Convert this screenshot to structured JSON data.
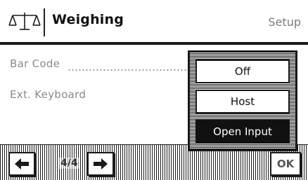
{
  "header": {
    "icon": "balance-scale-icon",
    "title": "Weighing",
    "right_label": "Setup"
  },
  "list": {
    "items": [
      {
        "label": "Bar Code"
      },
      {
        "label": "Ext. Keyboard"
      }
    ]
  },
  "popup": {
    "options": [
      {
        "label": "Off"
      },
      {
        "label": "Host"
      },
      {
        "label": "Open Input"
      }
    ],
    "selected_index": 2
  },
  "toolbar": {
    "back_icon": "arrow-left-icon",
    "page_indicator": "4/4",
    "next_icon": "arrow-right-icon",
    "ok_label": "OK"
  }
}
